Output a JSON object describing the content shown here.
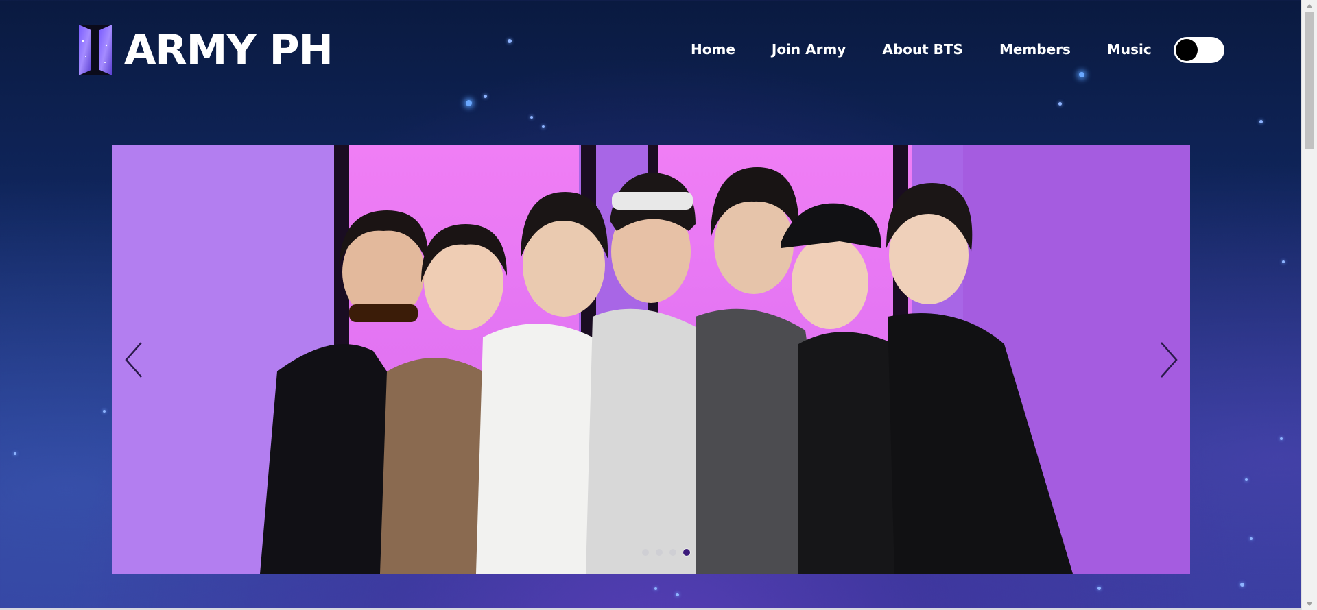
{
  "brand": {
    "name": "ARMY PH",
    "logo_icon": "bts-logo-icon"
  },
  "nav": {
    "items": [
      {
        "label": "Home"
      },
      {
        "label": "Join Army"
      },
      {
        "label": "About BTS"
      },
      {
        "label": "Members"
      },
      {
        "label": "Music"
      }
    ]
  },
  "theme_toggle": {
    "state": "off",
    "icon": "dark-mode-toggle"
  },
  "carousel": {
    "image": "bts-group-photo",
    "total_slides": 4,
    "active_slide": 4,
    "prev_icon": "chevron-left-icon",
    "next_icon": "chevron-right-icon"
  },
  "colors": {
    "background_top": "#0a1a40",
    "background_bottom": "#2d3a95",
    "slide_bg": "#c77ff0",
    "active_dot": "#3b1a7a",
    "text": "#ffffff"
  }
}
